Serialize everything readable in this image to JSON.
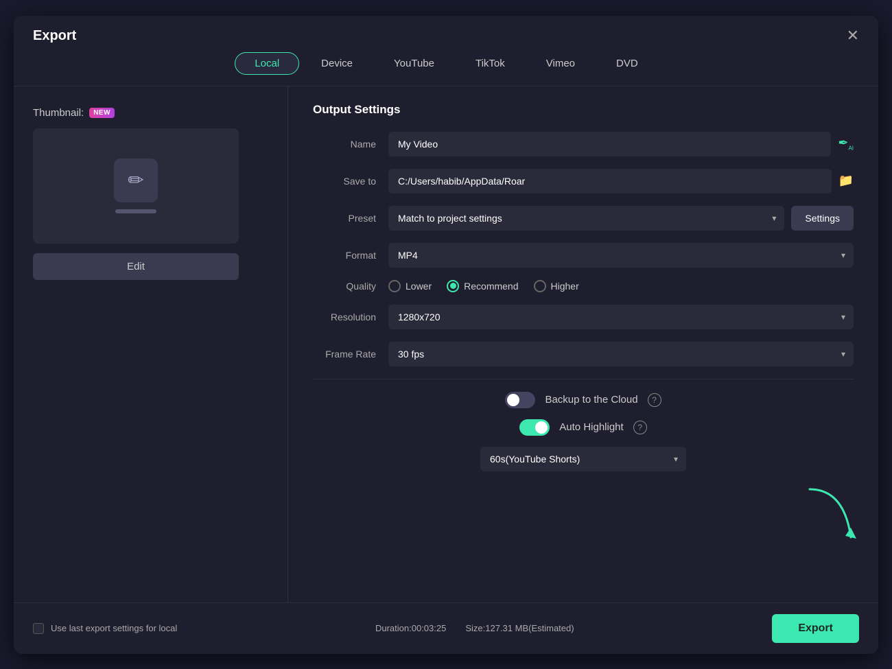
{
  "dialog": {
    "title": "Export",
    "close_label": "✕"
  },
  "tabs": [
    {
      "id": "local",
      "label": "Local",
      "active": true
    },
    {
      "id": "device",
      "label": "Device",
      "active": false
    },
    {
      "id": "youtube",
      "label": "YouTube",
      "active": false
    },
    {
      "id": "tiktok",
      "label": "TikTok",
      "active": false
    },
    {
      "id": "vimeo",
      "label": "Vimeo",
      "active": false
    },
    {
      "id": "dvd",
      "label": "DVD",
      "active": false
    }
  ],
  "left": {
    "thumbnail_label": "Thumbnail:",
    "new_badge": "NEW",
    "edit_button": "Edit"
  },
  "output_settings": {
    "title": "Output Settings",
    "name_label": "Name",
    "name_value": "My Video",
    "save_to_label": "Save to",
    "save_to_value": "C:/Users/habib/AppData/Roar",
    "preset_label": "Preset",
    "preset_value": "Match to project settings",
    "settings_btn": "Settings",
    "format_label": "Format",
    "format_value": "MP4",
    "quality_label": "Quality",
    "quality_options": [
      {
        "label": "Lower",
        "selected": false
      },
      {
        "label": "Recommend",
        "selected": true
      },
      {
        "label": "Higher",
        "selected": false
      }
    ],
    "resolution_label": "Resolution",
    "resolution_value": "1280x720",
    "frame_rate_label": "Frame Rate",
    "frame_rate_value": "30 fps"
  },
  "toggles": {
    "backup_label": "Backup to the Cloud",
    "backup_on": false,
    "auto_highlight_label": "Auto Highlight",
    "auto_highlight_on": true,
    "shorts_value": "60s(YouTube Shorts)"
  },
  "footer": {
    "use_last_label": "Use last export settings for local",
    "duration_label": "Duration:00:03:25",
    "size_label": "Size:127.31 MB(Estimated)",
    "export_btn": "Export"
  }
}
